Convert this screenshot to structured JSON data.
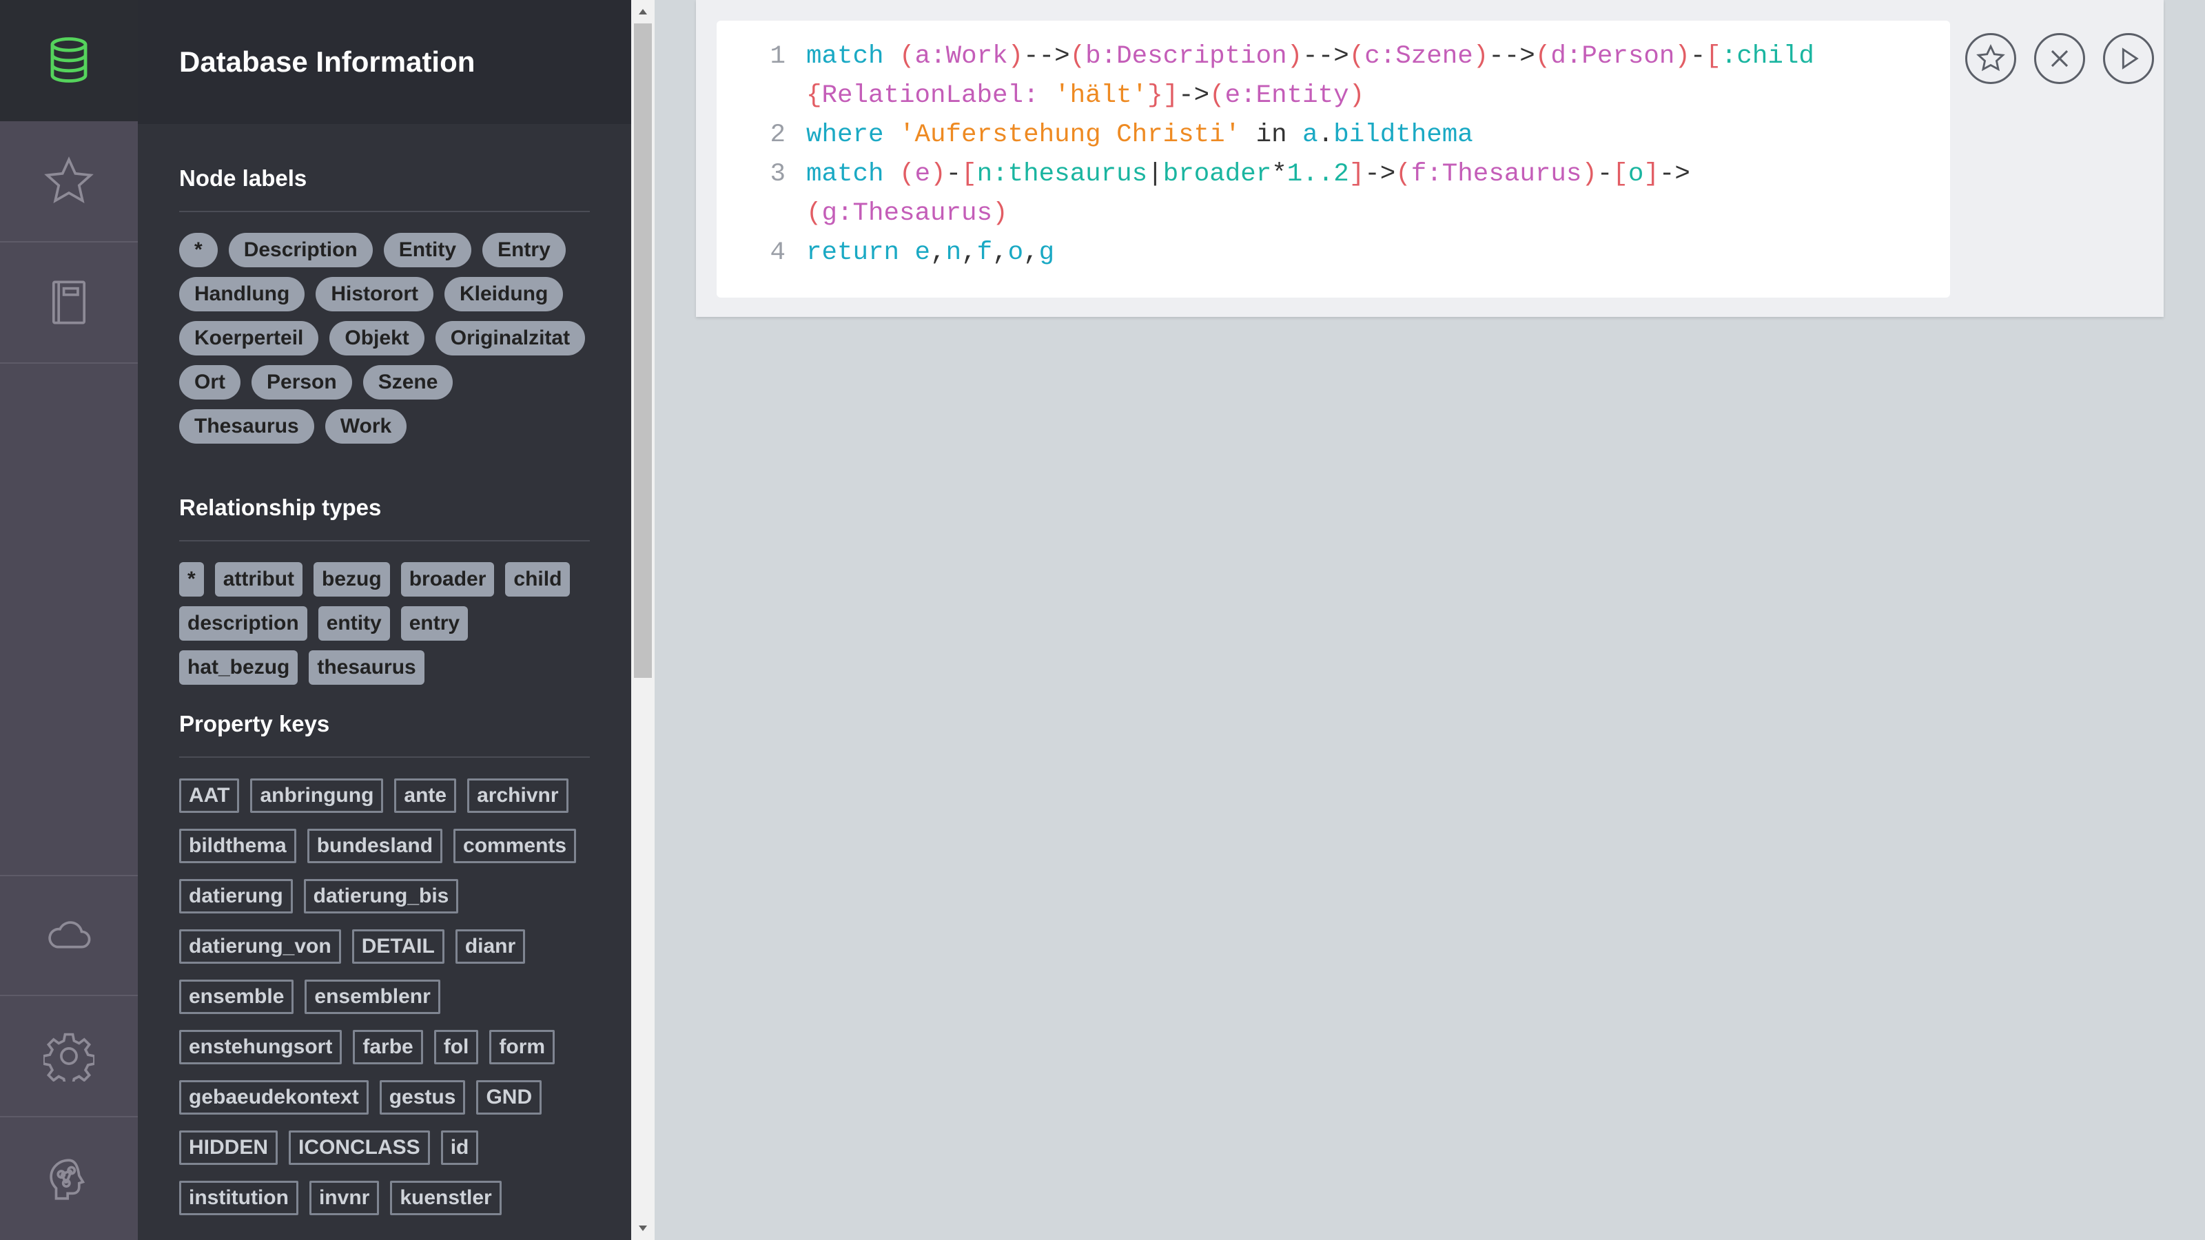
{
  "colors": {
    "rail_bg": "#4d4a57",
    "rail_active_bg": "#2b2d33",
    "drawer_bg": "#31333a",
    "db_icon_accent": "#55d35c",
    "main_bg": "#d2d7db"
  },
  "rail": {
    "items": [
      {
        "name": "database",
        "icon": "database-icon",
        "active": true
      },
      {
        "name": "favorites",
        "icon": "star-icon"
      },
      {
        "name": "documents",
        "icon": "book-icon"
      },
      {
        "name": "sync",
        "icon": "cloud-icon"
      },
      {
        "name": "settings",
        "icon": "gear-icon"
      },
      {
        "name": "about",
        "icon": "neo4j-brain-icon"
      }
    ]
  },
  "drawer": {
    "title": "Database Information",
    "node_labels": {
      "title": "Node labels",
      "items": [
        "*",
        "Description",
        "Entity",
        "Entry",
        "Handlung",
        "Historort",
        "Kleidung",
        "Koerperteil",
        "Objekt",
        "Originalzitat",
        "Ort",
        "Person",
        "Szene",
        "Thesaurus",
        "Work"
      ]
    },
    "relationship_types": {
      "title": "Relationship types",
      "items": [
        "*",
        "attribut",
        "bezug",
        "broader",
        "child",
        "description",
        "entity",
        "entry",
        "hat_bezug",
        "thesaurus"
      ]
    },
    "property_keys": {
      "title": "Property keys",
      "items": [
        "AAT",
        "anbringung",
        "ante",
        "archivnr",
        "bildthema",
        "bundesland",
        "comments",
        "datierung",
        "datierung_bis",
        "datierung_von",
        "DETAIL",
        "dianr",
        "ensemble",
        "ensemblenr",
        "enstehungsort",
        "farbe",
        "fol",
        "form",
        "gebaeudekontext",
        "gestus",
        "GND",
        "HIDDEN",
        "ICONCLASS",
        "id",
        "institution",
        "invnr",
        "kuenstler"
      ]
    }
  },
  "editor": {
    "line_numbers": [
      "1",
      "",
      "2",
      "3",
      "",
      "4"
    ],
    "lines": [
      [
        [
          "kw",
          "match"
        ],
        [
          "op",
          " "
        ],
        [
          "par",
          "("
        ],
        [
          "lbl",
          "a:Work"
        ],
        [
          "par",
          ")"
        ],
        [
          "op",
          "-->"
        ],
        [
          "par",
          "("
        ],
        [
          "lbl",
          "b:Description"
        ],
        [
          "par",
          ")"
        ],
        [
          "op",
          "-->"
        ],
        [
          "par",
          "("
        ],
        [
          "lbl",
          "c:Szene"
        ],
        [
          "par",
          ")"
        ],
        [
          "op",
          "-->"
        ],
        [
          "par",
          "("
        ],
        [
          "lbl",
          "d:Person"
        ],
        [
          "par",
          ")"
        ],
        [
          "op",
          "-"
        ],
        [
          "par",
          "["
        ],
        [
          "rel",
          ":child"
        ]
      ],
      [
        [
          "par",
          "{"
        ],
        [
          "lbl",
          "RelationLabel: "
        ],
        [
          "str",
          "'hält'"
        ],
        [
          "par",
          "}]"
        ],
        [
          "op",
          "->"
        ],
        [
          "par",
          "("
        ],
        [
          "lbl",
          "e:Entity"
        ],
        [
          "par",
          ")"
        ]
      ],
      [
        [
          "kw",
          "where"
        ],
        [
          "op",
          " "
        ],
        [
          "str",
          "'Auferstehung Christi'"
        ],
        [
          "op",
          " in "
        ],
        [
          "kw",
          "a"
        ],
        [
          "op",
          "."
        ],
        [
          "kw",
          "bildthema"
        ]
      ],
      [
        [
          "kw",
          "match"
        ],
        [
          "op",
          " "
        ],
        [
          "par",
          "("
        ],
        [
          "lbl",
          "e"
        ],
        [
          "par",
          ")"
        ],
        [
          "op",
          "-"
        ],
        [
          "par",
          "["
        ],
        [
          "rel",
          "n:thesaurus"
        ],
        [
          "op",
          "|"
        ],
        [
          "rel",
          "broader"
        ],
        [
          "op",
          "*"
        ],
        [
          "num",
          "1..2"
        ],
        [
          "par",
          "]"
        ],
        [
          "op",
          "->"
        ],
        [
          "par",
          "("
        ],
        [
          "lbl",
          "f:Thesaurus"
        ],
        [
          "par",
          ")"
        ],
        [
          "op",
          "-"
        ],
        [
          "par",
          "["
        ],
        [
          "rel",
          "o"
        ],
        [
          "par",
          "]"
        ],
        [
          "op",
          "->"
        ]
      ],
      [
        [
          "par",
          "("
        ],
        [
          "lbl",
          "g:Thesaurus"
        ],
        [
          "par",
          ")"
        ]
      ],
      [
        [
          "kw",
          "return"
        ],
        [
          "op",
          " "
        ],
        [
          "kw",
          "e"
        ],
        [
          "op",
          ","
        ],
        [
          "kw",
          "n"
        ],
        [
          "op",
          ","
        ],
        [
          "kw",
          "f"
        ],
        [
          "op",
          ","
        ],
        [
          "kw",
          "o"
        ],
        [
          "op",
          ","
        ],
        [
          "kw",
          "g"
        ]
      ]
    ],
    "buttons": [
      "favorite",
      "clear",
      "run"
    ]
  }
}
